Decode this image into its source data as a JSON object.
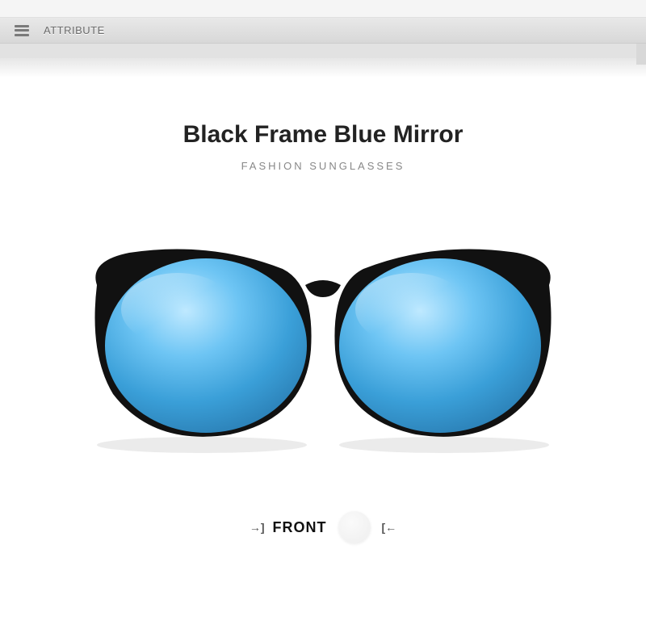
{
  "header": {
    "attribute_label": "ATTRIBUTE"
  },
  "product": {
    "title": "Black Frame Blue Mirror",
    "subtitle": "FASHION SUNGLASSES",
    "view_label": "FRONT"
  }
}
